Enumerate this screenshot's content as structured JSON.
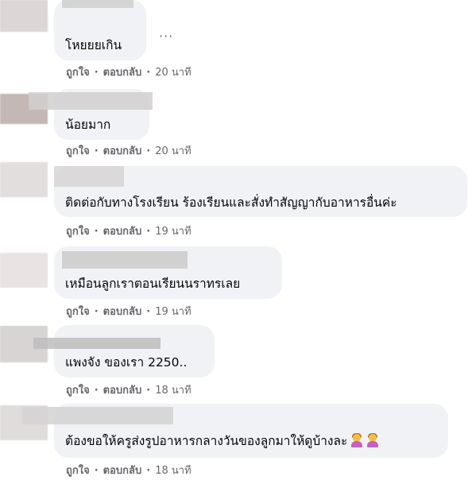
{
  "comments": [
    {
      "text": "โหยยยเกิน",
      "like_label": "ถูกใจ",
      "reply_label": "ตอบกลับ",
      "time": "20 นาที",
      "more_label": "···"
    },
    {
      "text": "น้อยมาก",
      "like_label": "ถูกใจ",
      "reply_label": "ตอบกลับ",
      "time": "20 นาที"
    },
    {
      "text": "ติดต่อกับทางโรงเรียน ร้องเรียนและสั่งทำสัญญากับอาหารอื่นค่ะ",
      "like_label": "ถูกใจ",
      "reply_label": "ตอบกลับ",
      "time": "19 นาที"
    },
    {
      "text": "เหมือนลูกเราตอนเรียนนราทรเลย",
      "like_label": "ถูกใจ",
      "reply_label": "ตอบกลับ",
      "time": "19 นาที"
    },
    {
      "text": "แพงจัง ของเรา 2250..",
      "like_label": "ถูกใจ",
      "reply_label": "ตอบกลับ",
      "time": "18 นาที"
    },
    {
      "text": "ต้องขอให้ครูส่งรูปอาหารกลางวันของลูกมาให้ดูบ้างละ",
      "like_label": "ถูกใจ",
      "reply_label": "ตอบกลับ",
      "time": "18 นาที",
      "emoji": "person-gesturing-emoji"
    }
  ],
  "separator": "·"
}
